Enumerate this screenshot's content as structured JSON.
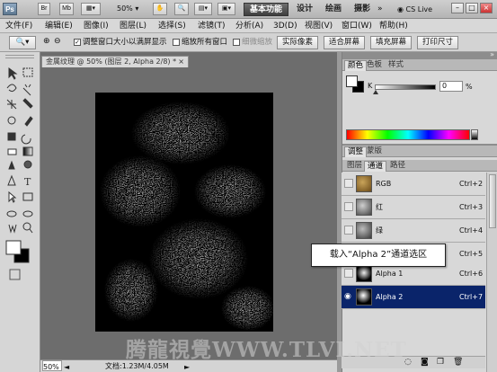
{
  "app": {
    "logo": "Ps",
    "bridge_btn": "Br",
    "minibridge_btn": "Mb",
    "zoom": "50%",
    "workspaces": [
      "基本功能",
      "设计",
      "绘画",
      "摄影"
    ],
    "cslive": "CS Live"
  },
  "menu": [
    "文件(F)",
    "编辑(E)",
    "图像(I)",
    "图层(L)",
    "选择(S)",
    "滤镜(T)",
    "分析(A)",
    "3D(D)",
    "视图(V)",
    "窗口(W)",
    "帮助(H)"
  ],
  "options": {
    "resize_windows": "调整窗口大小以满屏显示",
    "zoom_all": "缩放所有窗口",
    "scrubby_zoom": "细微缩放",
    "actual_pixels": "实际像素",
    "fit_screen": "适合屏幕",
    "fill_screen": "填充屏幕",
    "print_size": "打印尺寸"
  },
  "document": {
    "tab_title": "金属纹理 @ 50% (图层 2, Alpha 2/8) *",
    "tab_close": "×",
    "status_zoom": "50%",
    "status_doc": "文档:1.23M/4.05M"
  },
  "color_panel": {
    "tabs": [
      "颜色",
      "色板",
      "样式"
    ],
    "channel_label": "K",
    "value": "0",
    "unit": "%"
  },
  "adjust_panel": {
    "tabs": [
      "调整",
      "蒙版"
    ]
  },
  "channels_panel": {
    "tabs": [
      "图层",
      "通道",
      "路径"
    ],
    "rows": [
      {
        "name": "RGB",
        "shortcut": "Ctrl+2"
      },
      {
        "name": "红",
        "shortcut": "Ctrl+3"
      },
      {
        "name": "绿",
        "shortcut": "Ctrl+4"
      },
      {
        "name": "蓝",
        "shortcut": "Ctrl+5"
      },
      {
        "name": "Alpha 1",
        "shortcut": "Ctrl+6"
      },
      {
        "name": "Alpha 2",
        "shortcut": "Ctrl+7"
      }
    ]
  },
  "callout": "载入“Alpha 2”通道选区",
  "watermark": "腾龍視覺WWW.TLVI.NET",
  "colors": {
    "selected_channel": "#0a246a",
    "workspace_active": "#4a4a4a",
    "canvas_bg": "#6d6d6d"
  }
}
